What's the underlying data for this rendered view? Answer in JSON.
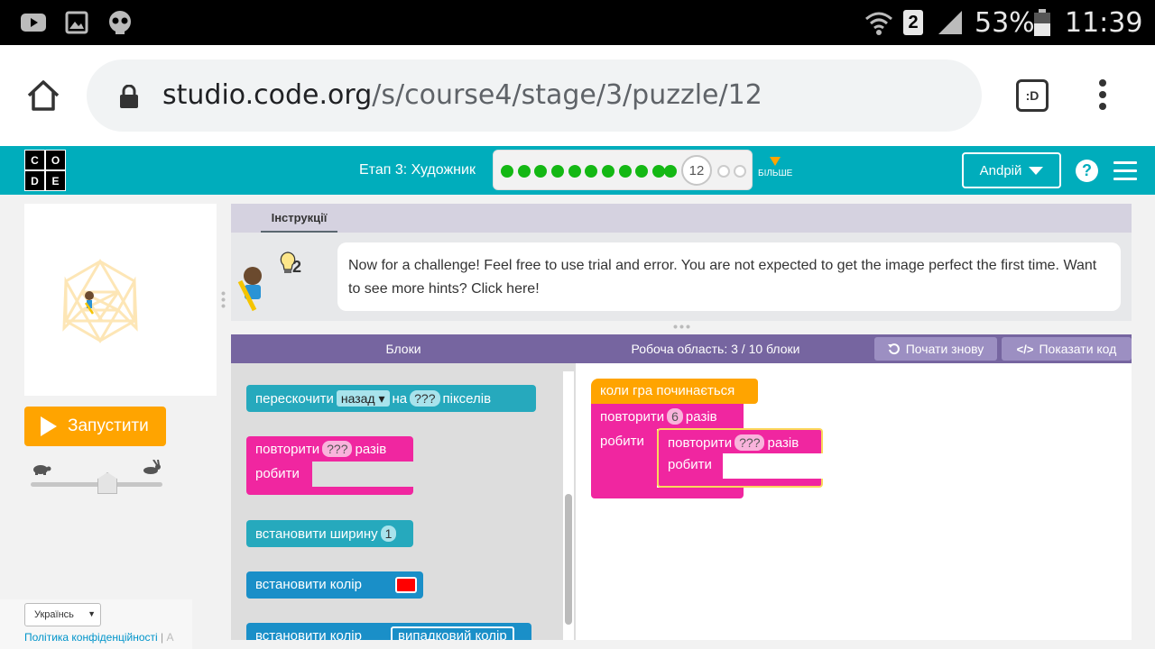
{
  "status_bar": {
    "battery": "53%",
    "time": "11:39",
    "sim": "2"
  },
  "browser": {
    "url_host": "studio.code.org",
    "url_path": "/s/course4/stage/3/puzzle/12",
    "tab_badge": ":D"
  },
  "header": {
    "logo_letters": [
      "C",
      "O",
      "D",
      "E"
    ],
    "stage_title": "Етап 3: Художник",
    "current_puzzle": "12",
    "completed_count": 11,
    "remaining_count": 2,
    "more_label": "БІЛЬШЕ",
    "user_name": "Andрій",
    "help_label": "?"
  },
  "left": {
    "run_label": "Запустити",
    "language": "Українсь",
    "privacy_label": "Політика конфіденційності",
    "privacy_sep": "|",
    "privacy_next": "А"
  },
  "instructions": {
    "tab_label": "Інструкції",
    "hint_count": "2",
    "text": "Now for a challenge! Feel free to use trial and error. You are not expected to get the image perfect the first time. Want to see more hints? Click here!"
  },
  "toolbox": {
    "header": "Блоки",
    "jump": {
      "prefix": "перескочити",
      "direction": "назад",
      "middle": "на",
      "amount": "???",
      "suffix": "пікселів"
    },
    "repeat": {
      "prefix": "повторити",
      "amount": "???",
      "suffix": "разів",
      "do": "робити"
    },
    "width": {
      "label": "встановити ширину",
      "value": "1"
    },
    "color": {
      "label": "встановити колір"
    },
    "random_color": {
      "label": "встановити колір",
      "value": "випадковий колір"
    }
  },
  "workspace": {
    "title": "Робоча область: 3 / 10 блоки",
    "restart_label": "Почати знову",
    "show_code_label": "Показати код",
    "when_run": "коли гра починається",
    "outer_repeat": {
      "prefix": "повторити",
      "amount": "6",
      "suffix": "разів",
      "do": "робити"
    },
    "inner_repeat": {
      "prefix": "повторити",
      "amount": "???",
      "suffix": "разів",
      "do": "робити"
    }
  },
  "colors": {
    "header_teal": "#00adbc",
    "run_orange": "#ffa400",
    "block_pink": "#f026a0",
    "block_teal": "#26a9bd",
    "block_blue": "#1a8fc8",
    "progress_green": "#14b814",
    "panel_purple": "#7665a0"
  }
}
